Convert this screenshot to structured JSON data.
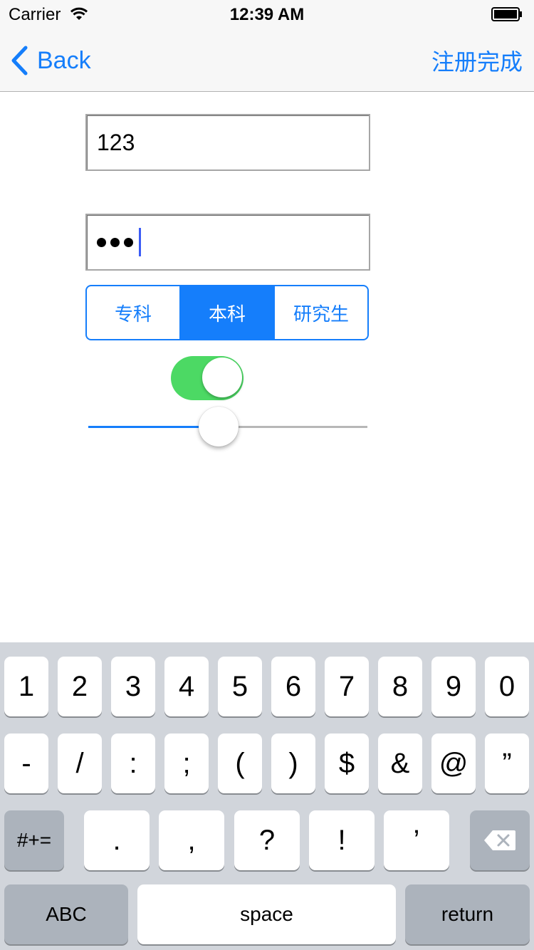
{
  "status_bar": {
    "carrier": "Carrier",
    "time": "12:39 AM"
  },
  "nav": {
    "back_label": "Back",
    "done_label": "注册完成"
  },
  "form": {
    "username_value": "123",
    "password_length": 3,
    "segments": [
      "专科",
      "本科",
      "研究生"
    ],
    "selected_segment": 1,
    "switch_on": true,
    "slider_value": 0.46
  },
  "keyboard": {
    "row1": [
      "1",
      "2",
      "3",
      "4",
      "5",
      "6",
      "7",
      "8",
      "9",
      "0"
    ],
    "row2": [
      "-",
      "/",
      ":",
      ";",
      "(",
      ")",
      "$",
      "&",
      "@",
      "”"
    ],
    "row3": [
      ".",
      ",",
      "?",
      "!",
      "’"
    ],
    "mode_label": "#+=",
    "abc_label": "ABC",
    "space_label": "space",
    "return_label": "return"
  },
  "colors": {
    "accent": "#157efb",
    "switch_on": "#4cd964",
    "keyboard_bg": "#d1d5db"
  }
}
